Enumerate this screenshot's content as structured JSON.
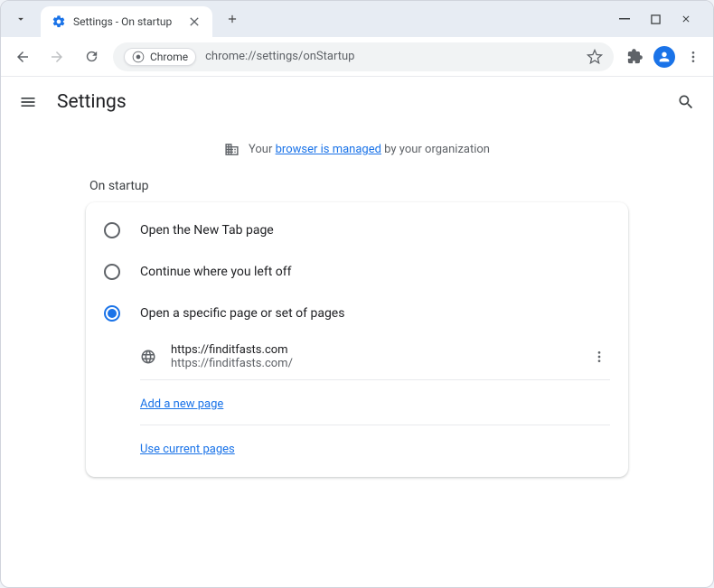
{
  "window": {
    "tab_title": "Settings - On startup"
  },
  "toolbar": {
    "site_chip": "Chrome",
    "url": "chrome://settings/onStartup"
  },
  "header": {
    "title": "Settings"
  },
  "banner": {
    "prefix": "Your ",
    "link": "browser is managed",
    "suffix": " by your organization"
  },
  "section": {
    "label": "On startup"
  },
  "options": {
    "new_tab": "Open the New Tab page",
    "continue": "Continue where you left off",
    "specific": "Open a specific page or set of pages"
  },
  "pages": [
    {
      "title": "https://finditfasts.com",
      "url": "https://finditfasts.com/"
    }
  ],
  "actions": {
    "add_page": "Add a new page",
    "use_current": "Use current pages"
  }
}
